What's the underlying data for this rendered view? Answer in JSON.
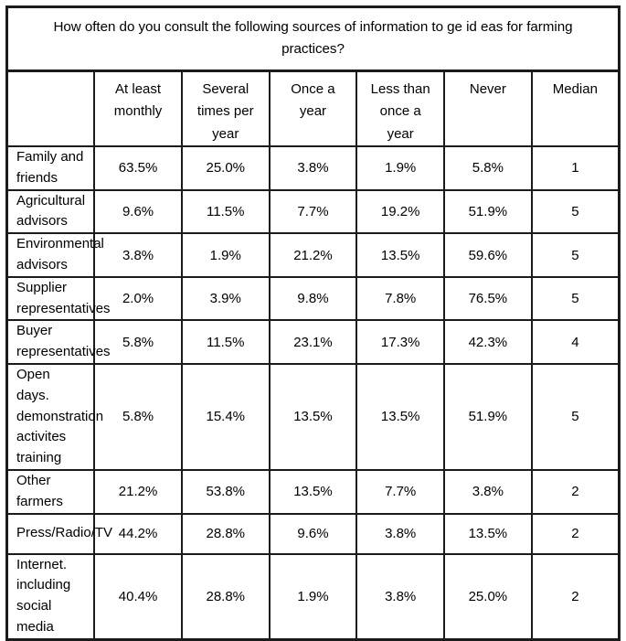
{
  "title": "How often do you consult the following sources of information to ge id eas for farming practices?",
  "table": {
    "columns": [
      {
        "label": ""
      },
      {
        "label": "At least monthly"
      },
      {
        "label": "Several times per year"
      },
      {
        "label": "Once a year"
      },
      {
        "label": "Less than once a year"
      },
      {
        "label": "Never"
      },
      {
        "label": "Median"
      }
    ],
    "rows": [
      {
        "label": "Family and friends",
        "lines": [
          "Family and friends"
        ],
        "values": [
          "63.5%",
          "25.0%",
          "3.8%",
          "1.9%",
          "5.8%",
          "1"
        ]
      },
      {
        "label": "Agricultural advisors",
        "lines": [
          "Agricultural advisors"
        ],
        "values": [
          "9.6%",
          "11.5%",
          "7.7%",
          "19.2%",
          "51.9%",
          "5"
        ]
      },
      {
        "label": "Environmental advisors",
        "lines": [
          "Environmental advisors"
        ],
        "values": [
          "3.8%",
          "1.9%",
          "21.2%",
          "13.5%",
          "59.6%",
          "5"
        ]
      },
      {
        "label": "Supplier representatives",
        "lines": [
          "Supplier representatives"
        ],
        "values": [
          "2.0%",
          "3.9%",
          "9.8%",
          "7.8%",
          "76.5%",
          "5"
        ]
      },
      {
        "label": "Buyer representatives",
        "lines": [
          "Buyer representatives"
        ],
        "values": [
          "5.8%",
          "11.5%",
          "23.1%",
          "17.3%",
          "42.3%",
          "4"
        ]
      },
      {
        "label": "Open days. demonstration activites training",
        "lines": [
          "Open days.",
          "demonstration",
          "activites training"
        ],
        "values": [
          "5.8%",
          "15.4%",
          "13.5%",
          "13.5%",
          "51.9%",
          "5"
        ]
      },
      {
        "label": "Other farmers",
        "lines": [
          "Other farmers"
        ],
        "values": [
          "21.2%",
          "53.8%",
          "13.5%",
          "7.7%",
          "3.8%",
          "2"
        ]
      },
      {
        "label": "Press/Radio/TV",
        "lines": [
          "Press/Radio/TV"
        ],
        "values": [
          "44.2%",
          "28.8%",
          "9.6%",
          "3.8%",
          "13.5%",
          "2"
        ]
      },
      {
        "label": "Internet. including social media",
        "lines": [
          "Internet. including",
          "social media"
        ],
        "values": [
          "40.4%",
          "28.8%",
          "1.9%",
          "3.8%",
          "25.0%",
          "2"
        ]
      }
    ]
  },
  "chart_data": {
    "type": "table",
    "title": "How often do you consult the following sources of information to ge id eas for farming practices?",
    "categories": [
      "Family and friends",
      "Agricultural advisors",
      "Environmental advisors",
      "Supplier representatives",
      "Buyer representatives",
      "Open days. demonstration activites training",
      "Other farmers",
      "Press/Radio/TV",
      "Internet. including social media"
    ],
    "series": [
      {
        "name": "At least monthly",
        "values": [
          63.5,
          9.6,
          3.8,
          2.0,
          5.8,
          5.8,
          21.2,
          44.2,
          40.4
        ]
      },
      {
        "name": "Several times per year",
        "values": [
          25.0,
          11.5,
          1.9,
          3.9,
          11.5,
          15.4,
          53.8,
          28.8,
          28.8
        ]
      },
      {
        "name": "Once a year",
        "values": [
          3.8,
          7.7,
          21.2,
          9.8,
          23.1,
          13.5,
          13.5,
          9.6,
          1.9
        ]
      },
      {
        "name": "Less than once a year",
        "values": [
          1.9,
          19.2,
          13.5,
          7.8,
          17.3,
          13.5,
          7.7,
          3.8,
          3.8
        ]
      },
      {
        "name": "Never",
        "values": [
          5.8,
          51.9,
          59.6,
          76.5,
          42.3,
          51.9,
          3.8,
          13.5,
          25.0
        ]
      },
      {
        "name": "Median",
        "values": [
          1,
          5,
          5,
          5,
          4,
          5,
          2,
          2,
          2
        ]
      }
    ],
    "units": "percent of respondents",
    "xlabel": "",
    "ylabel": ""
  }
}
